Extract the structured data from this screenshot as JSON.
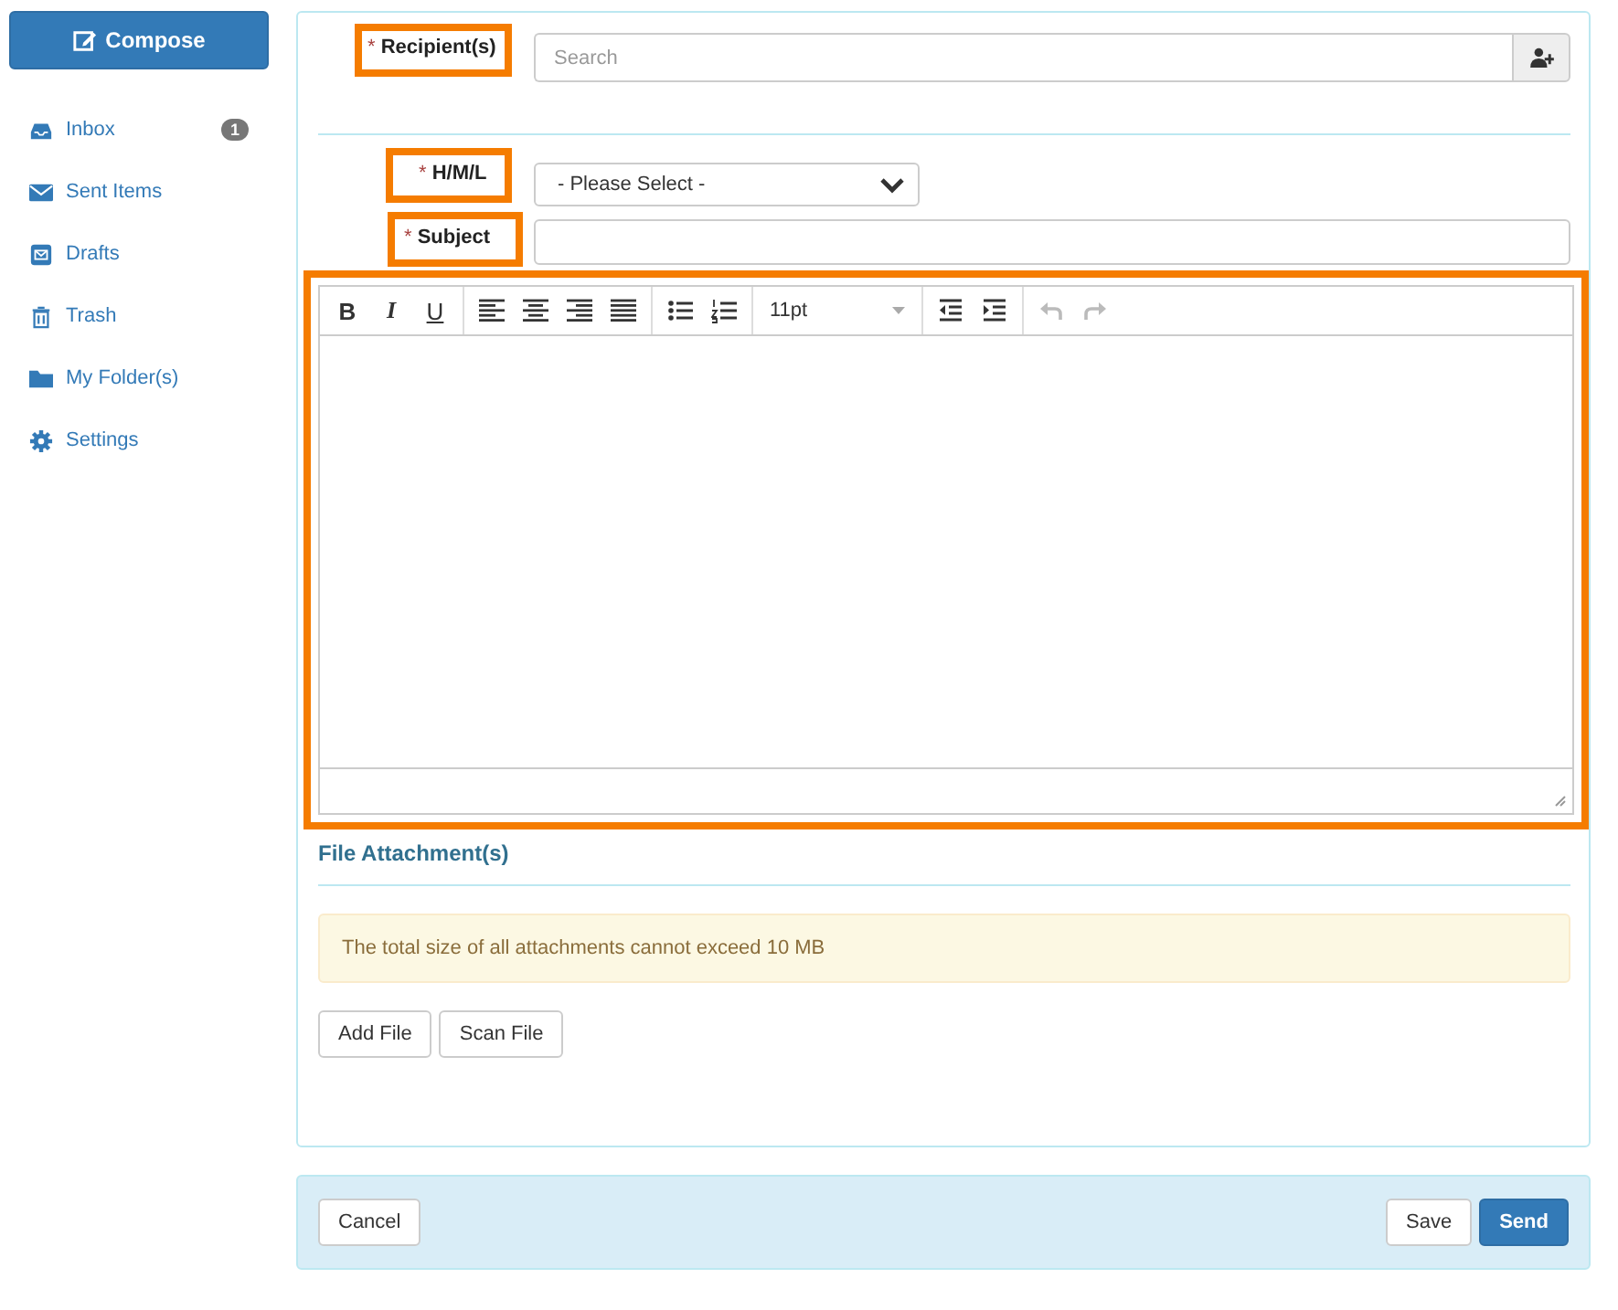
{
  "sidebar": {
    "compose": "Compose",
    "items": [
      {
        "kind": "inbox",
        "label": "Inbox",
        "badge": "1"
      },
      {
        "kind": "sent",
        "label": "Sent Items"
      },
      {
        "kind": "drafts",
        "label": "Drafts"
      },
      {
        "kind": "trash",
        "label": "Trash"
      },
      {
        "kind": "folder",
        "label": "My Folder(s)"
      },
      {
        "kind": "settings",
        "label": "Settings"
      }
    ]
  },
  "form": {
    "recipients": {
      "mark": "*",
      "label": "Recipient(s)",
      "placeholder": "Search"
    },
    "priority": {
      "mark": "*",
      "label": "H/M/L",
      "value": "- Please Select -"
    },
    "subject": {
      "mark": "*",
      "label": "Subject"
    }
  },
  "toolbar": [
    [
      {
        "kind": "bold",
        "text": "B"
      },
      {
        "kind": "italic",
        "text": "I"
      },
      {
        "kind": "underline",
        "text": "U"
      }
    ],
    [
      {
        "kind": "align-left"
      },
      {
        "kind": "align-center"
      },
      {
        "kind": "align-right"
      },
      {
        "kind": "justify"
      }
    ],
    [
      {
        "kind": "bullets"
      },
      {
        "kind": "numbers"
      }
    ],
    [
      {
        "kind": "font-size",
        "text": "11pt"
      }
    ],
    [
      {
        "kind": "outdent"
      },
      {
        "kind": "indent"
      }
    ],
    [
      {
        "kind": "undo",
        "disabled": true
      },
      {
        "kind": "redo",
        "disabled": true
      }
    ]
  ],
  "attachments": {
    "title": "File Attachment(s)",
    "notice": "The total size of all attachments cannot exceed 10 MB",
    "buttons": [
      "Add File",
      "Scan File"
    ]
  },
  "footer": {
    "left": [
      "Cancel"
    ],
    "right": [
      {
        "label": "Save",
        "primary": false
      },
      {
        "label": "Send",
        "primary": true
      }
    ]
  }
}
